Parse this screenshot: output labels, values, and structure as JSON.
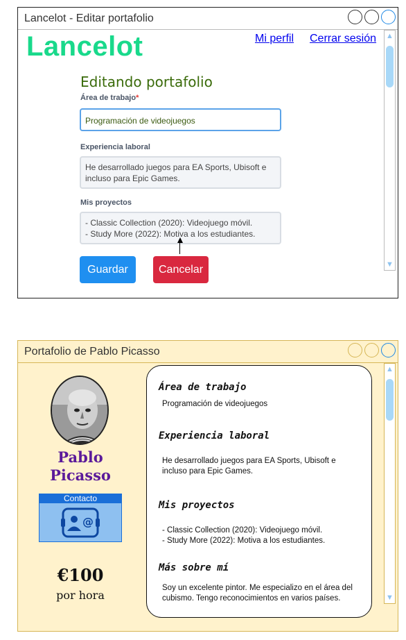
{
  "editor": {
    "window_title": "Lancelot - Editar portafolio",
    "brand": "Lancelot",
    "nav": {
      "profile": "Mi perfil",
      "logout": "Cerrar sesión"
    },
    "form_title": "Editando portafolio",
    "fields": {
      "area_label": "Área de trabajo",
      "area_required": "*",
      "area_value": "Programación de videojuegos",
      "experience_label": "Experiencia laboral",
      "experience_value": "He desarrollado juegos para EA Sports, Ubisoft e incluso para Epic Games.",
      "projects_label": "Mis proyectos",
      "projects_line1": "- Classic Collection (2020): Videojuego móvil.",
      "projects_line2": "- Study More (2022): Motiva a los estudiantes."
    },
    "buttons": {
      "save": "Guardar",
      "cancel": "Cancelar"
    }
  },
  "portfolio": {
    "window_title": "Portafolio de Pablo Picasso",
    "name_line1": "Pablo",
    "name_line2": "Picasso",
    "contact_label": "Contacto",
    "contact_icon": "contact-card-icon",
    "price": "€100",
    "per_hour": "por hora",
    "sections": {
      "area_title": "Área de trabajo",
      "area_text": "Programación de videojuegos",
      "experience_title": "Experiencia laboral",
      "experience_text": "He desarrollado juegos para EA Sports, Ubisoft e incluso para Epic Games.",
      "projects_title": "Mis proyectos",
      "projects_line1": "- Classic Collection (2020): Videojuego móvil.",
      "projects_line2": "- Study More (2022): Motiva a los estudiantes.",
      "about_title": "Más sobre mí",
      "about_text": "Soy un excelente pintor. Me especializo en el área del cubismo. Tengo reconocimientos en varios países."
    }
  },
  "colors": {
    "brand": "#19d98b",
    "save": "#1f8ff0",
    "cancel": "#d9283f",
    "portfolio_bg": "#fff2cc",
    "name": "#5b1a9a"
  }
}
